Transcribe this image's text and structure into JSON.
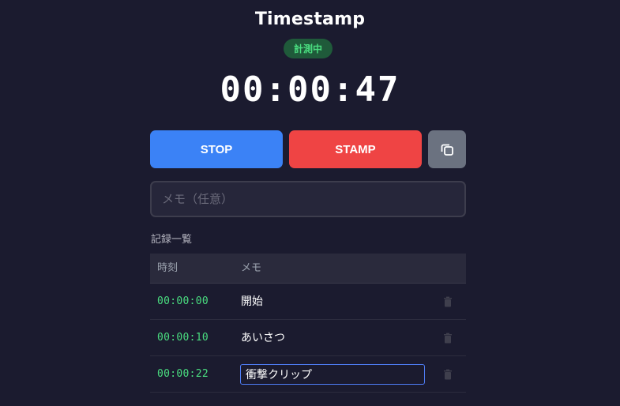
{
  "app": {
    "title": "Timestamp",
    "status": "計測中"
  },
  "timer": {
    "display": "00:00:47"
  },
  "controls": {
    "stop_label": "STOP",
    "stamp_label": "STAMP",
    "copy_icon": "copy-icon"
  },
  "memo": {
    "placeholder": "メモ（任意）",
    "value": ""
  },
  "records": {
    "heading": "記録一覧",
    "columns": {
      "time": "時刻",
      "memo": "メモ"
    },
    "rows": [
      {
        "time": "00:00:00",
        "memo": "開始"
      },
      {
        "time": "00:00:10",
        "memo": "あいさつ"
      },
      {
        "time": "00:00:22",
        "memo": "衝撃クリップ"
      }
    ],
    "delete_icon": "trash-icon"
  },
  "colors": {
    "background": "#1b1b2f",
    "stop": "#3b82f6",
    "stamp": "#ef4444",
    "copy": "#6b7280",
    "timestamp_text": "#4ade80",
    "status_badge_bg": "#1f5a3a"
  }
}
